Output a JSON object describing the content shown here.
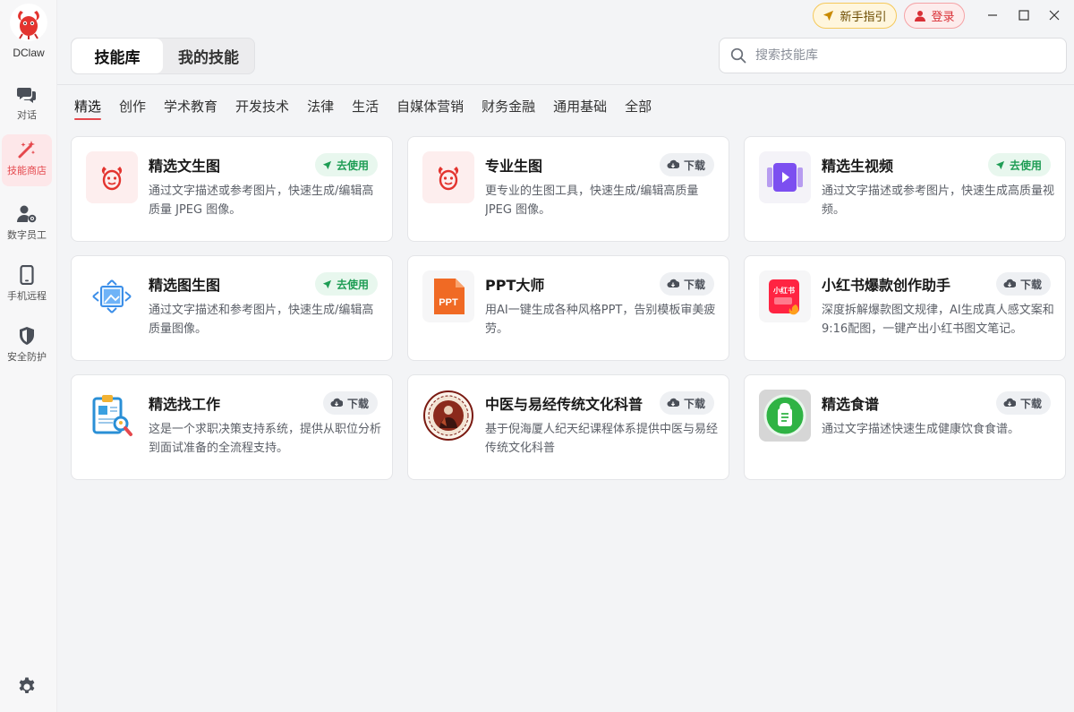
{
  "app": {
    "name": "DClaw"
  },
  "sidebar": {
    "items": [
      {
        "label": "对话",
        "icon": "chat-icon"
      },
      {
        "label": "技能商店",
        "icon": "magic-wand-icon",
        "active": true
      },
      {
        "label": "数字员工",
        "icon": "user-gear-icon"
      },
      {
        "label": "手机远程",
        "icon": "phone-icon"
      },
      {
        "label": "安全防护",
        "icon": "shield-icon"
      }
    ]
  },
  "header": {
    "guide_label": "新手指引",
    "login_label": "登录",
    "tabs": [
      {
        "label": "技能库",
        "active": true
      },
      {
        "label": "我的技能",
        "active": false
      }
    ],
    "search_placeholder": "搜索技能库"
  },
  "categories": [
    {
      "label": "精选",
      "active": true
    },
    {
      "label": "创作"
    },
    {
      "label": "学术教育"
    },
    {
      "label": "开发技术"
    },
    {
      "label": "法律"
    },
    {
      "label": "生活"
    },
    {
      "label": "自媒体营销"
    },
    {
      "label": "财务金融"
    },
    {
      "label": "通用基础"
    },
    {
      "label": "全部"
    }
  ],
  "skills": [
    {
      "title": "精选文生图",
      "desc": "通过文字描述或参考图片，快速生成/编辑高质量 JPEG 图像。",
      "action": "去使用",
      "icon": "lobster-icon"
    },
    {
      "title": "专业生图",
      "desc": "更专业的生图工具，快速生成/编辑高质量 JPEG 图像。",
      "action": "下载",
      "icon": "lobster-icon"
    },
    {
      "title": "精选生视频",
      "desc": "通过文字描述或参考图片，快速生成高质量视频。",
      "action": "去使用",
      "icon": "video-play-icon"
    },
    {
      "title": "精选图生图",
      "desc": "通过文字描述和参考图片，快速生成/编辑高质量图像。",
      "action": "去使用",
      "icon": "image-transform-icon"
    },
    {
      "title": "PPT大师",
      "desc": "用AI一键生成各种风格PPT，告别模板审美疲劳。",
      "action": "下载",
      "icon": "ppt-file-icon",
      "icon_text": "PPT"
    },
    {
      "title": "小红书爆款创作助手",
      "desc": "深度拆解爆款图文规律，AI生成真人感文案和9:16配图，一键产出小红书图文笔记。",
      "action": "下载",
      "icon": "xiaohongshu-icon",
      "icon_text": "小红书"
    },
    {
      "title": "精选找工作",
      "desc": "这是一个求职决策支持系统，提供从职位分析到面试准备的全流程支持。",
      "action": "下载",
      "icon": "resume-search-icon"
    },
    {
      "title": "中医与易经传统文化科普",
      "desc": "基于倪海厦人纪天纪课程体系提供中医与易经传统文化科普",
      "action": "下载",
      "icon": "tcm-portrait-icon"
    },
    {
      "title": "精选食谱",
      "desc": "通过文字描述快速生成健康饮食食谱。",
      "action": "下载",
      "icon": "recipe-icon"
    }
  ],
  "colors": {
    "accent": "#e5484d",
    "use_green": "#1f9d55",
    "background": "#f3f4f6"
  }
}
